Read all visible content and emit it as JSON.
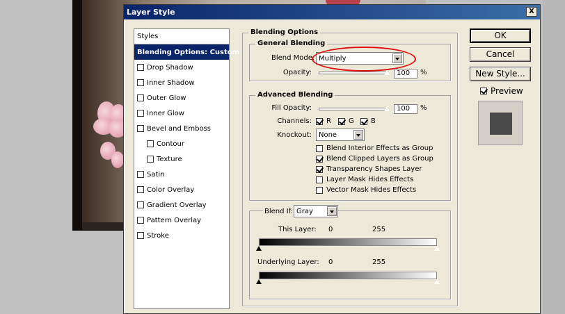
{
  "dialog": {
    "title": "Layer Style",
    "close_label": "X"
  },
  "styles": {
    "header": "Styles",
    "items": [
      {
        "label": "Blending Options: Custom",
        "active": true,
        "checkbox": false
      },
      {
        "label": "Drop Shadow",
        "checkbox": true,
        "checked": false
      },
      {
        "label": "Inner Shadow",
        "checkbox": true,
        "checked": false
      },
      {
        "label": "Outer Glow",
        "checkbox": true,
        "checked": false
      },
      {
        "label": "Inner Glow",
        "checkbox": true,
        "checked": false
      },
      {
        "label": "Bevel and Emboss",
        "checkbox": true,
        "checked": false
      },
      {
        "label": "Contour",
        "checkbox": true,
        "checked": false,
        "sub": true
      },
      {
        "label": "Texture",
        "checkbox": true,
        "checked": false,
        "sub": true
      },
      {
        "label": "Satin",
        "checkbox": true,
        "checked": false
      },
      {
        "label": "Color Overlay",
        "checkbox": true,
        "checked": false
      },
      {
        "label": "Gradient Overlay",
        "checkbox": true,
        "checked": false
      },
      {
        "label": "Pattern Overlay",
        "checkbox": true,
        "checked": false
      },
      {
        "label": "Stroke",
        "checkbox": true,
        "checked": false
      }
    ]
  },
  "blending": {
    "title": "Blending Options",
    "general": {
      "title": "General Blending",
      "blend_mode_label": "Blend Mode:",
      "blend_mode_value": "Multiply",
      "opacity_label": "Opacity:",
      "opacity_value": "100",
      "percent": "%"
    },
    "advanced": {
      "title": "Advanced Blending",
      "fill_opacity_label": "Fill Opacity:",
      "fill_opacity_value": "100",
      "percent": "%",
      "channels_label": "Channels:",
      "channel_r": "R",
      "channel_g": "G",
      "channel_b": "B",
      "knockout_label": "Knockout:",
      "knockout_value": "None",
      "options": [
        {
          "label": "Blend Interior Effects as Group",
          "checked": false
        },
        {
          "label": "Blend Clipped Layers as Group",
          "checked": true
        },
        {
          "label": "Transparency Shapes Layer",
          "checked": true
        },
        {
          "label": "Layer Mask Hides Effects",
          "checked": false
        },
        {
          "label": "Vector Mask Hides Effects",
          "checked": false
        }
      ]
    },
    "blend_if": {
      "label": "Blend If:",
      "value": "Gray",
      "this_layer_label": "This Layer:",
      "this_layer_min": "0",
      "this_layer_max": "255",
      "underlying_label": "Underlying Layer:",
      "underlying_min": "0",
      "underlying_max": "255"
    }
  },
  "buttons": {
    "ok": "OK",
    "cancel": "Cancel",
    "new_style": "New Style...",
    "preview_label": "Preview",
    "preview_checked": true
  },
  "colors": {
    "titlebar": "#0a246a",
    "highlight": "#e01010",
    "dialog_bg": "#ece9d8"
  }
}
